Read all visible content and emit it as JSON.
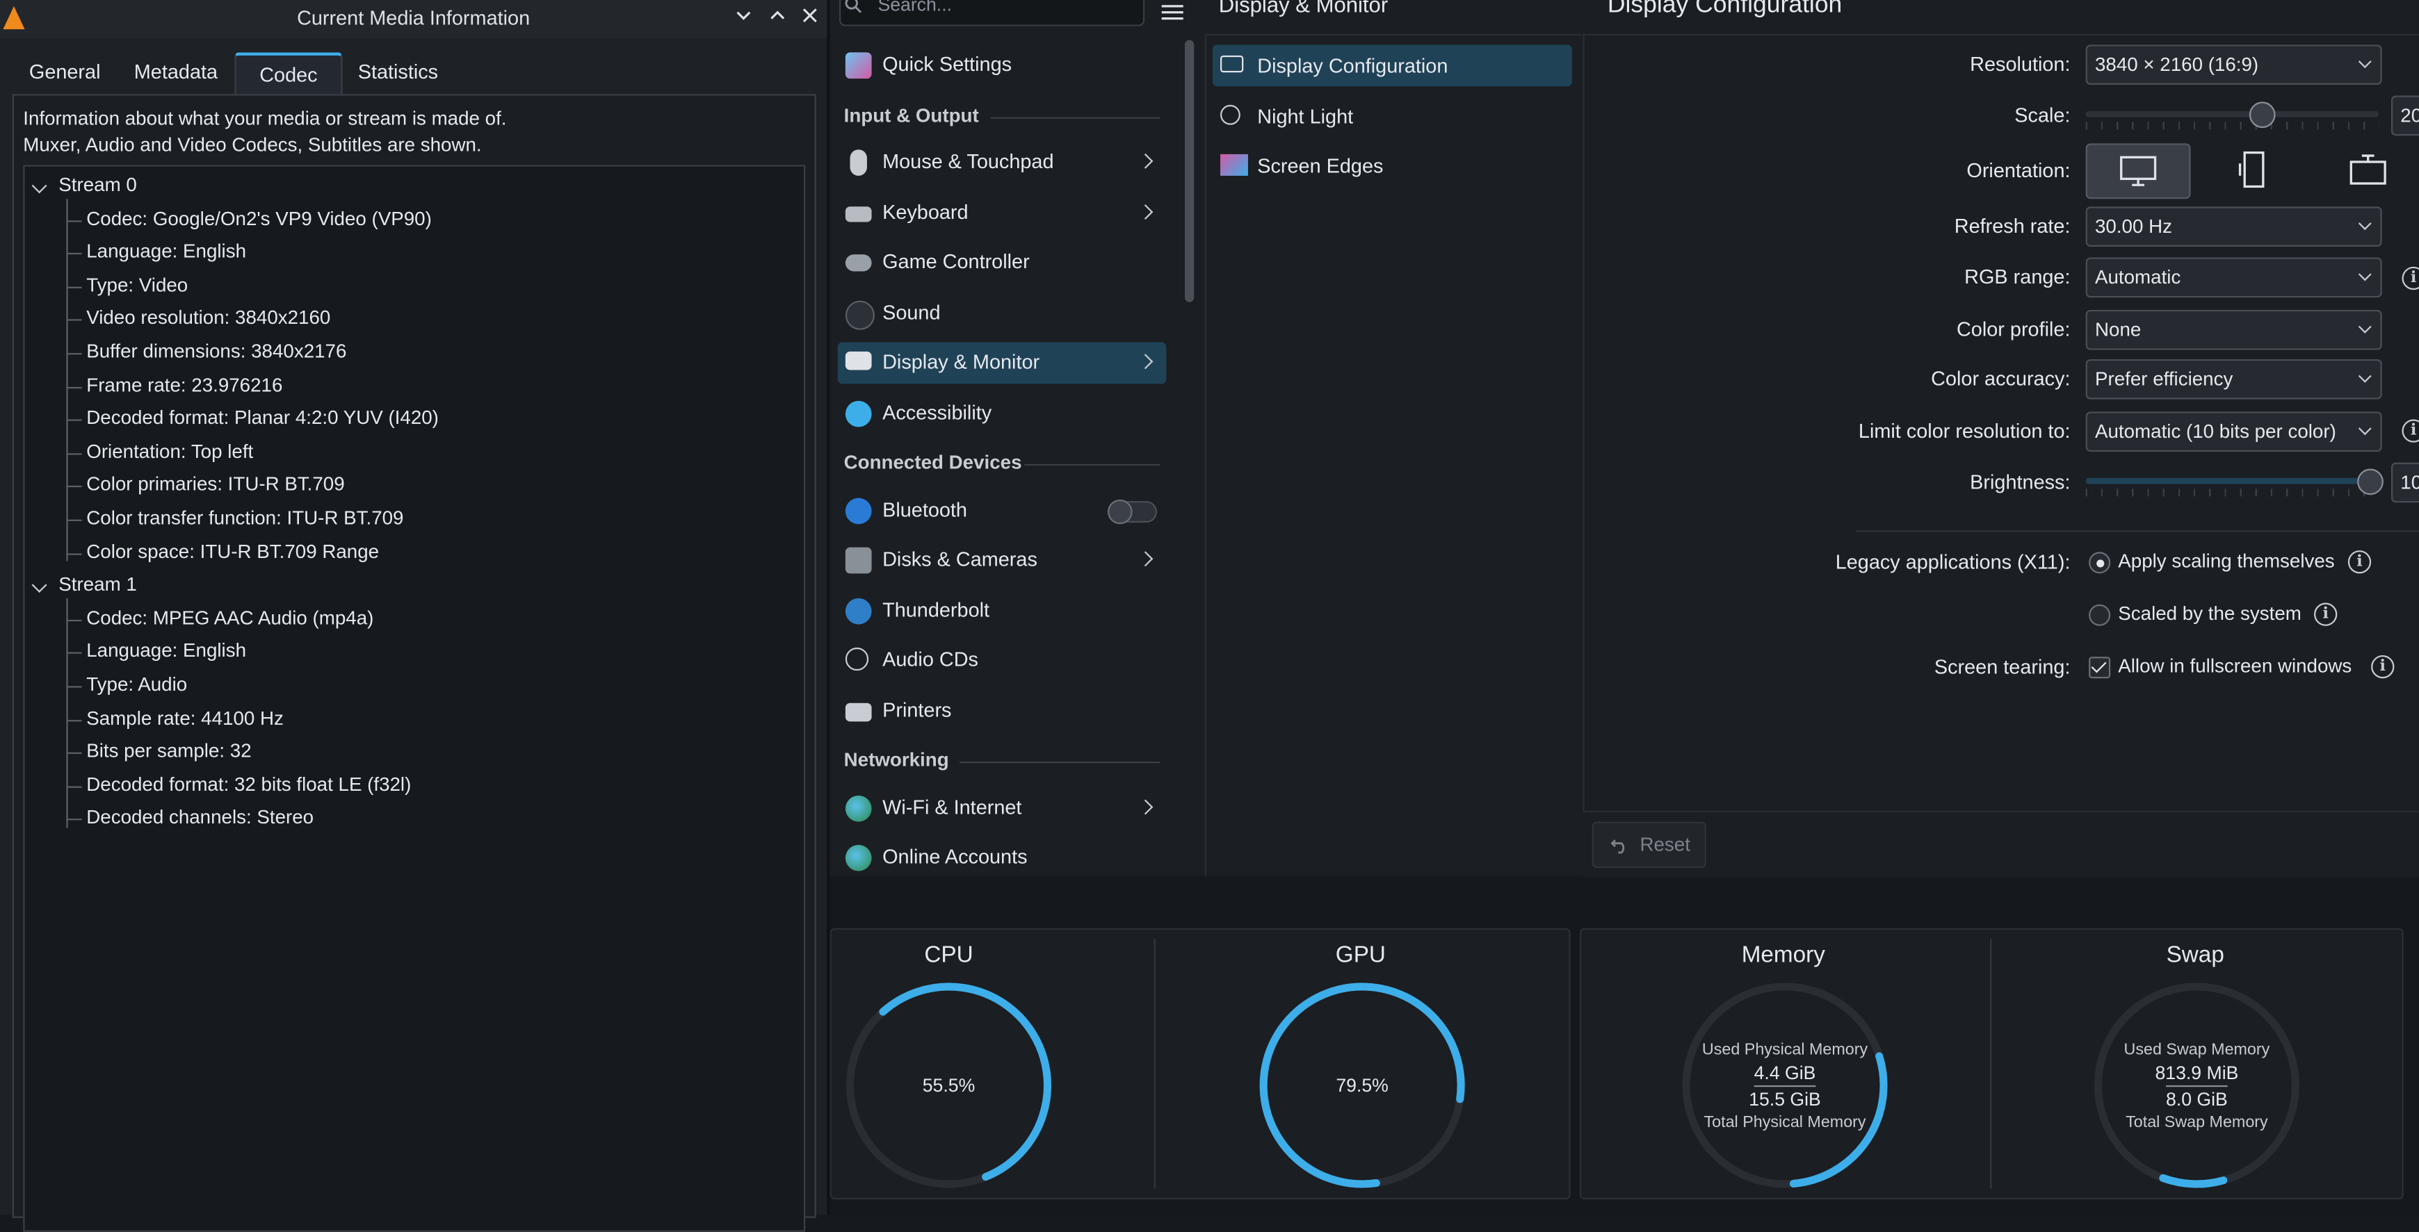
{
  "vlc": {
    "window_title": "Current Media Information",
    "tabs": [
      "General",
      "Metadata",
      "Codec",
      "Statistics"
    ],
    "active_tab": "Codec",
    "intro_line1": "Information about what your media or stream is made of.",
    "intro_line2": "Muxer, Audio and Video Codecs, Subtitles are shown.",
    "streams": [
      {
        "label": "Stream 0",
        "items": [
          "Codec: Google/On2's VP9 Video (VP90)",
          "Language: English",
          "Type: Video",
          "Video resolution: 3840x2160",
          "Buffer dimensions: 3840x2176",
          "Frame rate: 23.976216",
          "Decoded format: Planar 4:2:0 YUV (I420)",
          "Orientation: Top left",
          "Color primaries: ITU-R BT.709",
          "Color transfer function: ITU-R BT.709",
          "Color space: ITU-R BT.709 Range"
        ]
      },
      {
        "label": "Stream 1",
        "items": [
          "Codec: MPEG AAC Audio (mp4a)",
          "Language: English",
          "Type: Audio",
          "Sample rate: 44100 Hz",
          "Bits per sample: 32",
          "Decoded format: 32 bits float LE (f32l)",
          "Decoded channels: Stereo"
        ]
      }
    ]
  },
  "settings": {
    "search_placeholder": "Search...",
    "sidebar": {
      "quick_settings": "Quick Settings",
      "section_input_output": "Input & Output",
      "mouse": "Mouse & Touchpad",
      "keyboard": "Keyboard",
      "game_controller": "Game Controller",
      "sound": "Sound",
      "display": "Display & Monitor",
      "accessibility": "Accessibility",
      "section_connected": "Connected Devices",
      "bluetooth": "Bluetooth",
      "disks": "Disks & Cameras",
      "thunderbolt": "Thunderbolt",
      "audio_cds": "Audio CDs",
      "printers": "Printers",
      "section_networking": "Networking",
      "wifi": "Wi-Fi & Internet",
      "online_accounts": "Online Accounts"
    },
    "subcategory_header": "Display & Monitor",
    "subcategories": [
      "Display Configuration",
      "Night Light",
      "Screen Edges"
    ],
    "page_header": "Display Configuration",
    "form": {
      "resolution_label": "Resolution:",
      "resolution_value": "3840 × 2160 (16:9)",
      "scale_label": "Scale:",
      "scale_value": "20",
      "orientation_label": "Orientation:",
      "refresh_label": "Refresh rate:",
      "refresh_value": "30.00 Hz",
      "rgb_label": "RGB range:",
      "rgb_value": "Automatic",
      "profile_label": "Color profile:",
      "profile_value": "None",
      "accuracy_label": "Color accuracy:",
      "accuracy_value": "Prefer efficiency",
      "limit_label": "Limit color resolution to:",
      "limit_value": "Automatic  (10 bits per color)",
      "brightness_label": "Brightness:",
      "brightness_value": "10",
      "legacy_label": "Legacy applications (X11):",
      "legacy_opt1": "Apply scaling themselves",
      "legacy_opt2": "Scaled by the system",
      "tearing_label": "Screen tearing:",
      "tearing_opt": "Allow in fullscreen windows"
    },
    "reset_label": "Reset"
  },
  "monitor": {
    "cpu_title": "CPU",
    "cpu_value": "55.5%",
    "cpu_fraction": 0.555,
    "gpu_title": "GPU",
    "gpu_value": "79.5%",
    "gpu_fraction": 0.795,
    "mem_title": "Memory",
    "mem_used_label": "Used Physical Memory",
    "mem_used": "4.4 GiB",
    "mem_total": "15.5 GiB",
    "mem_total_label": "Total Physical Memory",
    "mem_fraction": 0.284,
    "swap_title": "Swap",
    "swap_used_label": "Used Swap Memory",
    "swap_used": "813.9 MiB",
    "swap_total": "8.0 GiB",
    "swap_total_label": "Total Swap Memory",
    "swap_fraction": 0.099
  },
  "colors": {
    "accent": "#3daee9",
    "selection": "#1f4257",
    "background": "#1b1e22"
  }
}
